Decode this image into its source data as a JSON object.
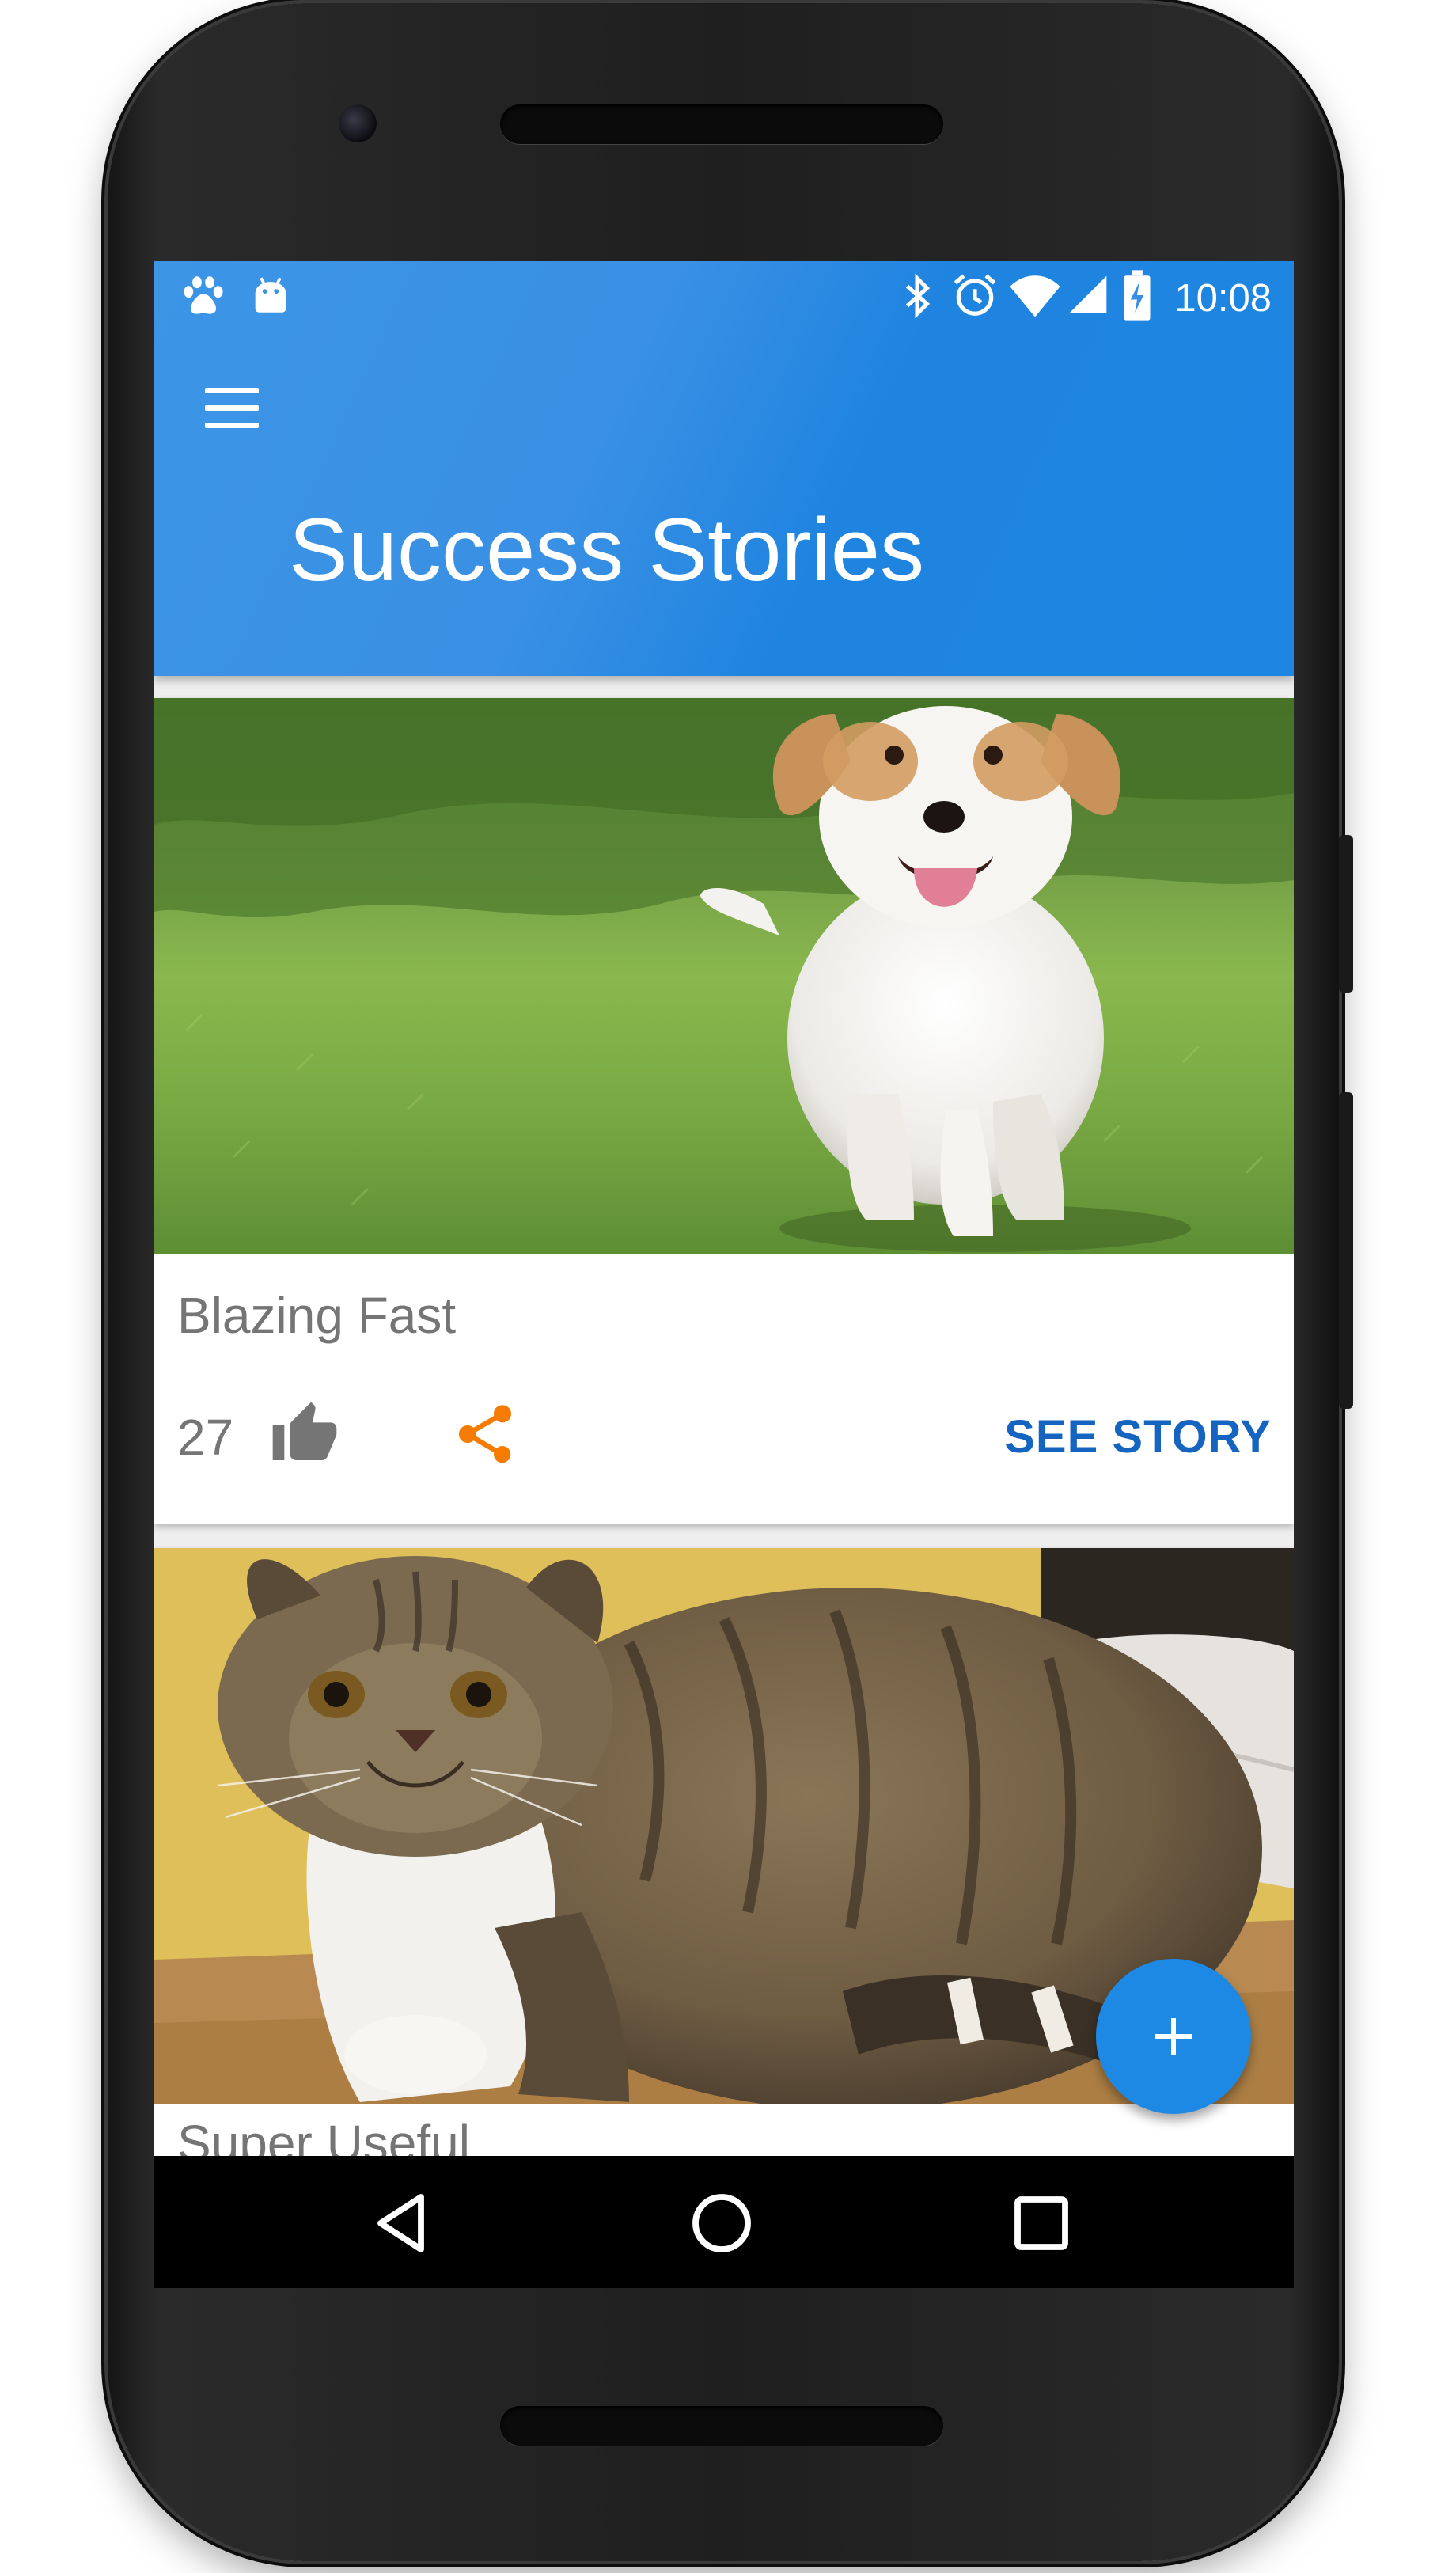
{
  "status_bar": {
    "time": "10:08",
    "left_icons": [
      "paw-icon",
      "android-icon"
    ],
    "right_icons": [
      "bluetooth-icon",
      "alarm-icon",
      "wifi-icon",
      "cell-signal-icon",
      "battery-charging-icon"
    ]
  },
  "app_bar": {
    "menu_icon": "menu-icon",
    "title": "Success Stories",
    "color": "#1e88e5"
  },
  "cards": [
    {
      "title": "Blazing Fast",
      "likes": "27",
      "like_icon": "thumb-up-icon",
      "share_icon": "share-icon",
      "action": "SEE STORY",
      "image": "dog-running-photo"
    },
    {
      "title": "Super Useful",
      "image": "cat-photo"
    }
  ],
  "fab": {
    "icon": "add-icon",
    "color": "#1e88e5"
  },
  "nav_bar": {
    "icons": [
      "back-icon",
      "home-icon",
      "recents-icon"
    ]
  },
  "colors": {
    "accent": "#1e88e5",
    "share": "#f57c00",
    "link": "#1565c0",
    "text_secondary": "#757575"
  }
}
